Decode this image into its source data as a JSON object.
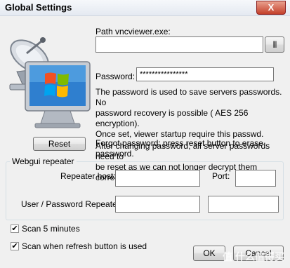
{
  "window": {
    "title": "Global Settings",
    "close_label": "X"
  },
  "path": {
    "label": "Path vncviewer.exe:",
    "value": "",
    "browse_label": "|||"
  },
  "password": {
    "label": "Password:",
    "value": "****************"
  },
  "description": {
    "line1": "The password is used to save servers passwords.  No",
    "line2": "password recovery is possible ( AES 256 encryption).",
    "line3": "Once set, viewer startup require this passwd.",
    "line4": "After changing password, all server passwords need to",
    "line5": "be reset as we can not longer decrypt them correct."
  },
  "reset": {
    "button_label": "Reset",
    "forgot_line1": "Forgot password: press reset button to erase",
    "forgot_line2": "password."
  },
  "webgui": {
    "group_title": "Webgui repeater",
    "repeater_host_label": "Repeater host:",
    "repeater_host_value": "",
    "port_label": "Port:",
    "port_value": "",
    "user_password_label": "User / Password Repeater:",
    "user_value": "",
    "password_value": ""
  },
  "options": {
    "scan_5_minutes": {
      "label": "Scan 5 minutes",
      "checked": true,
      "mark": "✔"
    },
    "scan_refresh": {
      "label": "Scan when refresh button is used",
      "checked": true,
      "mark": "✔"
    }
  },
  "footer": {
    "ok_label": "OK",
    "cancel_label": "Cancel"
  },
  "watermark": "值 什么值得买"
}
